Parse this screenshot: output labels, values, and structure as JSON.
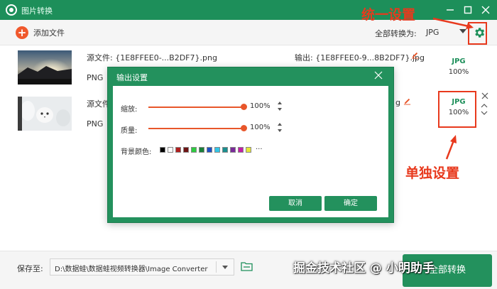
{
  "window": {
    "title": "图片转换",
    "accent_color": "#1d8f5a"
  },
  "toolbar": {
    "add_label": "添加文件",
    "convert_all_label": "全部转换为:",
    "convert_all_value": "JPG"
  },
  "files": [
    {
      "source_label": "源文件: {1E8FFEE0-...B2DF7}.png",
      "format": "PNG",
      "output_label": "输出: {1E8FFEE0-9...8B2DF7}.jpg",
      "target_format": "JPG",
      "quality": "100%"
    },
    {
      "source_label": "源文件",
      "format": "PNG",
      "output_label": "g",
      "target_format": "JPG",
      "quality": "100%"
    }
  ],
  "dialog": {
    "title": "输出设置",
    "zoom_label": "缩放:",
    "zoom_value": "100%",
    "zoom_fraction": 1.0,
    "quality_label": "质量:",
    "quality_value": "100%",
    "quality_fraction": 1.0,
    "bg_color_label": "背景颜色:",
    "bg_colors": [
      "#000000",
      "#ffffff",
      "#b01e1e",
      "#6e1414",
      "#2ecc40",
      "#1a7f3a",
      "#1f4fc4",
      "#33c6e6",
      "#1a8f8f",
      "#7a2a9a",
      "#c31fa6",
      "#e6e63a"
    ],
    "more_label": "···",
    "cancel_label": "取消",
    "confirm_label": "确定"
  },
  "bottom": {
    "save_label": "保存至:",
    "save_path": "D:\\数据蛙\\数据蛙视频转换器\\Image Converter",
    "convert_label": "全部转换"
  },
  "annotations": {
    "unified": "统一设置",
    "single": "单独设置",
    "color": "#e8391d"
  },
  "watermark": "掘金技术社区 @ 小明助手"
}
